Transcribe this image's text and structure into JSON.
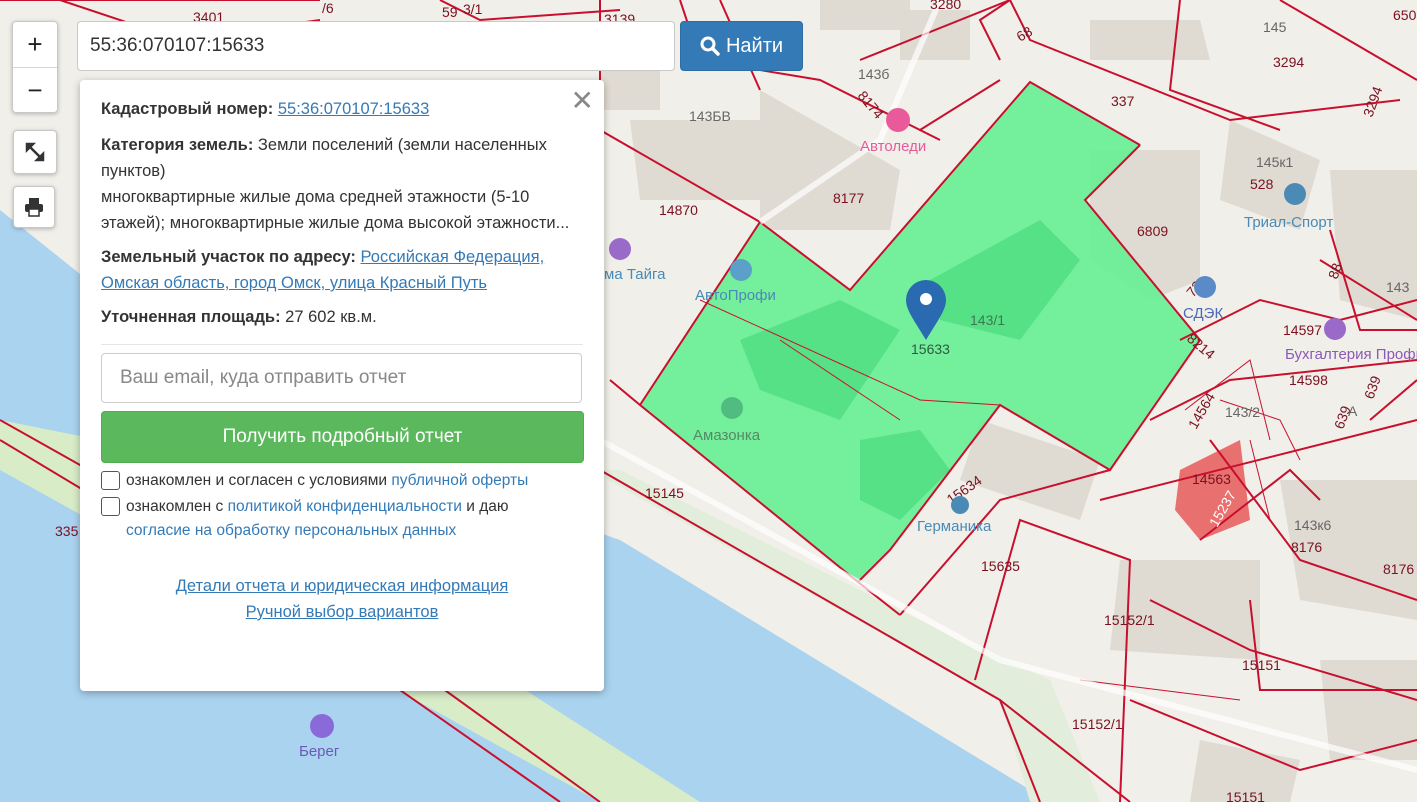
{
  "search": {
    "value": "55:36:070107:15633",
    "button_label": "Найти"
  },
  "zoom": {
    "in_label": "+",
    "out_label": "−"
  },
  "info": {
    "cadastral_label": "Кадастровый номер:",
    "cadastral_value": "55:36:070107:15633",
    "category_label": "Категория земель:",
    "category_value": "Земли поселений (земли населенных пунктов)",
    "usage_text": "многоквартирные жилые дома средней этажности (5-10 этажей); многоквартирные жилые дома высокой этажности...",
    "address_label": "Земельный участок по адресу:",
    "address_value": "Российская Федерация, Омская область, город Омск, улица Красный Путь",
    "area_label": "Уточненная площадь:",
    "area_value": "27 602 кв.м.",
    "close": "✕"
  },
  "form": {
    "email_placeholder": "Ваш email, куда отправить отчет",
    "submit_label": "Получить подробный отчет",
    "agree1_text": "ознакомлен и согласен с условиями ",
    "agree1_link": "публичной оферты",
    "agree2_text": "ознакомлен с ",
    "agree2_link": "политикой конфиденциальности",
    "agree2_mid": " и даю ",
    "agree2_link2": "согласие на обработку персональных данных",
    "details_link": "Детали отчета и юридическая информация",
    "manual_link": "Ручной выбор вариантов"
  },
  "map": {
    "marker_label": "15633",
    "parcel_color": "#5ef08f",
    "boundary_color": "#c8102e",
    "water_color": "#aad3ef",
    "park_color": "#d8ecc8",
    "poi": [
      {
        "name": "Автоледи",
        "icon": "beauty-icon"
      },
      {
        "name": "АвтоПрофи",
        "icon": "car-service-icon"
      },
      {
        "name": "Амазонка",
        "icon": "spa-icon"
      },
      {
        "name": "Германика",
        "icon": "pharmacy-icon"
      },
      {
        "name": "Триал-Спорт",
        "icon": "shop-icon"
      },
      {
        "name": "СДЭК",
        "icon": "delivery-icon"
      },
      {
        "name": "Бухгалтерия Профи",
        "icon": "office-icon"
      },
      {
        "name": "ма Тайга",
        "icon": "place-icon"
      },
      {
        "name": "Берег",
        "icon": "park-icon"
      }
    ],
    "labels": [
      "3401",
      "59",
      "3/1",
      "3139",
      "3280",
      "650",
      "/6",
      "68",
      "145",
      "3294",
      "143б",
      "143БВ",
      "8174",
      "337",
      "3294",
      "145к1",
      "528",
      "14870",
      "8177",
      "6809",
      "88",
      "143",
      "73",
      "143/1",
      "8214",
      "14597",
      "14598",
      "639",
      "639",
      "А",
      "14564",
      "143/2",
      "14563",
      "15237",
      "143к6",
      "8176",
      "8176",
      "15145",
      "15634",
      "15635",
      "15152/1",
      "15151",
      "15152/1",
      "15151",
      "335"
    ]
  }
}
